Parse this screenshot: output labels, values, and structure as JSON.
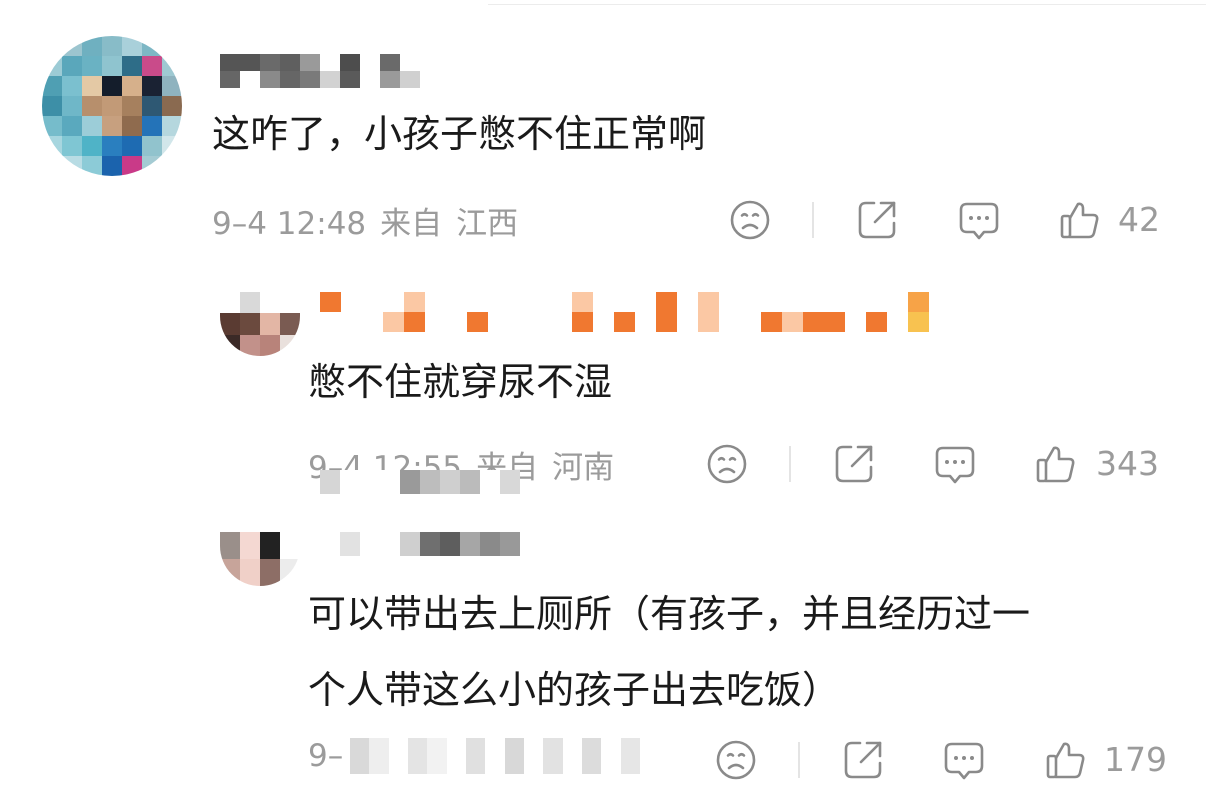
{
  "comments": [
    {
      "text": "这咋了，小孩子憋不住正常啊",
      "date": "9–4 12:48",
      "source_label": "来自",
      "location": "江西",
      "likes": "42"
    },
    {
      "text": "憋不住就穿尿不湿",
      "date": "9–4 12:55",
      "source_label": "来自",
      "location": "河南",
      "likes": "343"
    },
    {
      "text_lines": [
        "可以带出去上厕所（有孩子，并且经历过一",
        "个人带这么小的孩子出去吃饭）"
      ],
      "date": "9–",
      "likes": "179"
    }
  ],
  "icons": {
    "reaction": "emoji-face-icon",
    "share": "share-icon",
    "reply": "comment-icon",
    "like": "thumbs-up-icon"
  },
  "colors": {
    "text": "#1a1a1a",
    "meta": "#9b9b9b",
    "icon": "#8a8a8a",
    "divider": "#e4e4e4"
  }
}
